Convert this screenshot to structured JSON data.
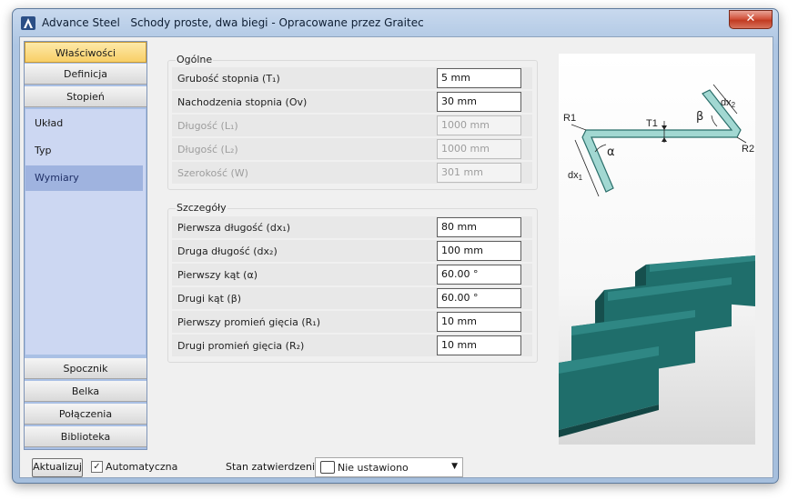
{
  "window": {
    "title": "Advance Steel   Schody proste, dwa biegi - Opracowane przez Graitec",
    "close_glyph": "✕"
  },
  "nav": {
    "tabs_top": [
      {
        "label": "Właściwości",
        "active": true
      },
      {
        "label": "Definicja",
        "active": false
      },
      {
        "label": "Stopień",
        "active": false
      }
    ],
    "sub_items": [
      {
        "label": "Układ",
        "selected": false
      },
      {
        "label": "Typ",
        "selected": false
      },
      {
        "label": "Wymiary",
        "selected": true
      }
    ],
    "tabs_bottom": [
      {
        "label": "Spocznik"
      },
      {
        "label": "Belka"
      },
      {
        "label": "Połączenia"
      },
      {
        "label": "Biblioteka"
      }
    ]
  },
  "general": {
    "title": "Ogólne",
    "rows": [
      {
        "label": "Grubość stopnia (T₁)",
        "value": "5 mm",
        "disabled": false
      },
      {
        "label": "Nachodzenia stopnia (Ov)",
        "value": "30 mm",
        "disabled": false
      },
      {
        "label": "Długość (L₁)",
        "value": "1000 mm",
        "disabled": true
      },
      {
        "label": "Długość (L₂)",
        "value": "1000 mm",
        "disabled": true
      },
      {
        "label": "Szerokość (W)",
        "value": "301 mm",
        "disabled": true
      }
    ]
  },
  "details": {
    "title": "Szczegóły",
    "rows": [
      {
        "label": "Pierwsza długość (dx₁)",
        "value": "80 mm"
      },
      {
        "label": "Druga długość (dx₂)",
        "value": "100 mm"
      },
      {
        "label": "Pierwszy kąt (α)",
        "value": "60.00 °"
      },
      {
        "label": "Drugi kąt (β)",
        "value": "60.00 °"
      },
      {
        "label": "Pierwszy promień gięcia (R₁)",
        "value": "10 mm"
      },
      {
        "label": "Drugi promień gięcia (R₂)",
        "value": "10 mm"
      }
    ]
  },
  "diagram": {
    "labels": {
      "r1": "R1",
      "r2": "R2",
      "t1": "T1",
      "alpha": "α",
      "beta": "β",
      "dx1": "dx",
      "dx1_sub": "1",
      "dx2": "dx",
      "dx2_sub": "2"
    },
    "colors": {
      "profile_fill": "#a2d8d2",
      "profile_stroke": "#2a6e6a",
      "step_color": "#1f6e6b"
    }
  },
  "bottom": {
    "update_label": "Aktualizuj",
    "auto_checked": true,
    "auto_label": "Automatyczna",
    "status_label": "Stan zatwierdzenia",
    "status_value": "Nie ustawiono"
  }
}
